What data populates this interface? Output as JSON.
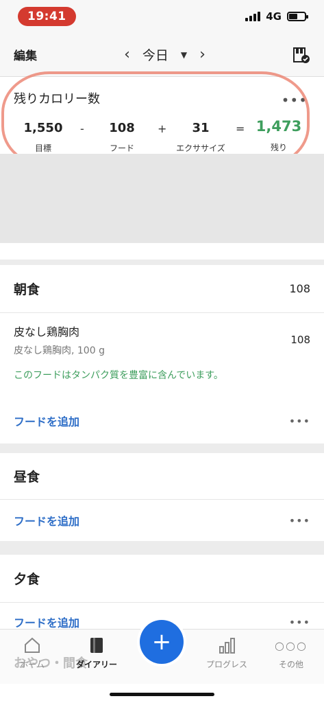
{
  "status_bar": {
    "time": "19:41",
    "network": "4G"
  },
  "topnav": {
    "edit_label": "編集",
    "date_label": "今日",
    "prev": "‹",
    "next": "›"
  },
  "calorie_card": {
    "title": "残りカロリー数",
    "goal_value": "1,550",
    "goal_label": "目標",
    "minus": "-",
    "food_value": "108",
    "food_label": "フード",
    "plus": "+",
    "exercise_value": "31",
    "exercise_label": "エクササイズ",
    "equals": "=",
    "remaining_value": "1,473",
    "remaining_label": "残り"
  },
  "breakfast": {
    "title": "朝食",
    "calories": "108",
    "food": {
      "name": "皮なし鶏胸肉",
      "detail": "皮なし鶏胸肉, 100 g",
      "calories": "108",
      "note": "このフードはタンパク質を豊富に含んでいます。"
    },
    "add_label": "フードを追加"
  },
  "lunch": {
    "title": "昼食",
    "add_label": "フードを追加"
  },
  "dinner": {
    "title": "夕食",
    "add_label": "フードを追加"
  },
  "snack_title": "おやつ・間食",
  "bottom_nav": {
    "home": "ホーム",
    "diary": "ダイアリー",
    "progress": "プログレス",
    "more": "その他",
    "add": "+"
  },
  "colors": {
    "accent": "#1f6ee0",
    "green": "#3e9e5d",
    "link": "#2e6ec7",
    "time_pill": "#d43a2f"
  }
}
